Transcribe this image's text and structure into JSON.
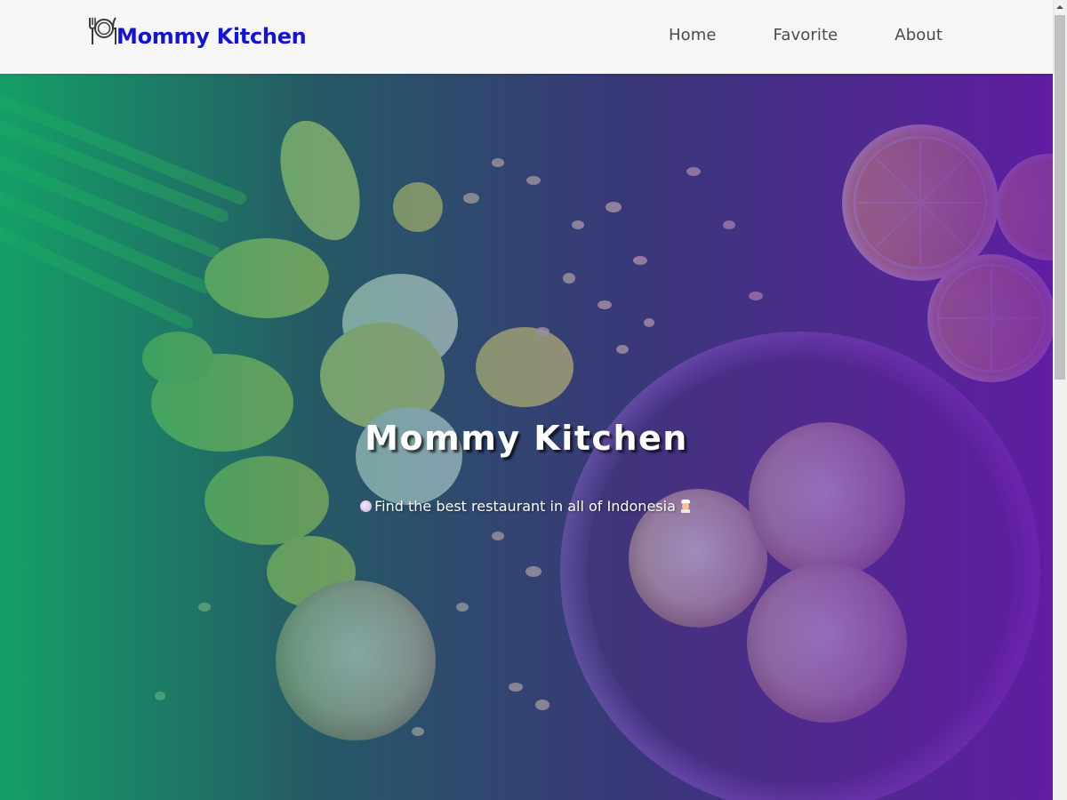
{
  "header": {
    "brand_name": "Mommy Kitchen",
    "brand_icon": "restaurant-plate-fork-knife-icon",
    "nav": [
      {
        "label": "Home"
      },
      {
        "label": "Favorite"
      },
      {
        "label": "About"
      }
    ]
  },
  "hero": {
    "title": "Mommy Kitchen",
    "tagline": "Find the best restaurant in all of Indonesia",
    "tagline_leading_icon": "white-circle-emoji-icon",
    "tagline_trailing_icon": "chef-emoji-icon",
    "background": "food-photo-daffodils-almond-cookies-lemon-slices"
  },
  "colors": {
    "brand": "#1414d6",
    "header_bg": "#f7f7f7",
    "gradient_start": "#12a868",
    "gradient_end": "#6919af"
  }
}
